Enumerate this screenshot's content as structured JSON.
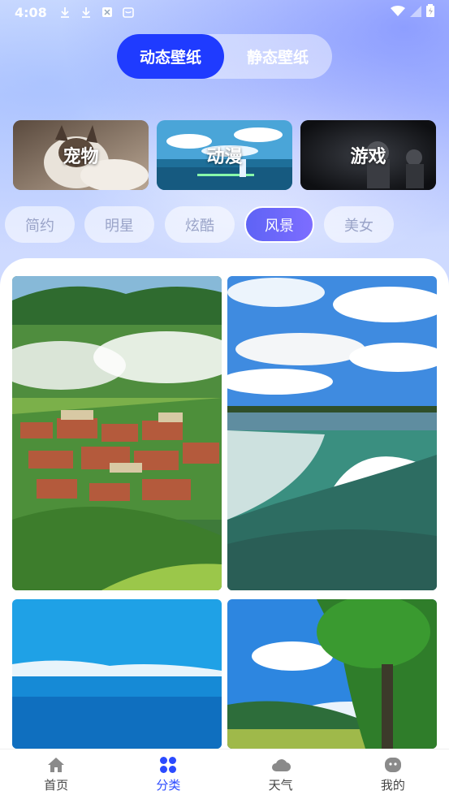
{
  "status": {
    "time": "4:08"
  },
  "segment": {
    "dynamic_label": "动态壁纸",
    "static_label": "静态壁纸"
  },
  "categories": [
    {
      "label": "宠物"
    },
    {
      "label": "动漫"
    },
    {
      "label": "游戏"
    }
  ],
  "tags": [
    {
      "label": "简约"
    },
    {
      "label": "明星"
    },
    {
      "label": "炫酷"
    },
    {
      "label": "风景",
      "active": true
    },
    {
      "label": "美女"
    }
  ],
  "nav": [
    {
      "label": "首页",
      "icon": "home-icon"
    },
    {
      "label": "分类",
      "icon": "grid-icon",
      "active": true
    },
    {
      "label": "天气",
      "icon": "cloud-icon"
    },
    {
      "label": "我的",
      "icon": "profile-icon"
    }
  ],
  "colors": {
    "accent": "#1f3bff",
    "tag_active": "#6a66f8",
    "nav_active": "#2b4bff"
  }
}
